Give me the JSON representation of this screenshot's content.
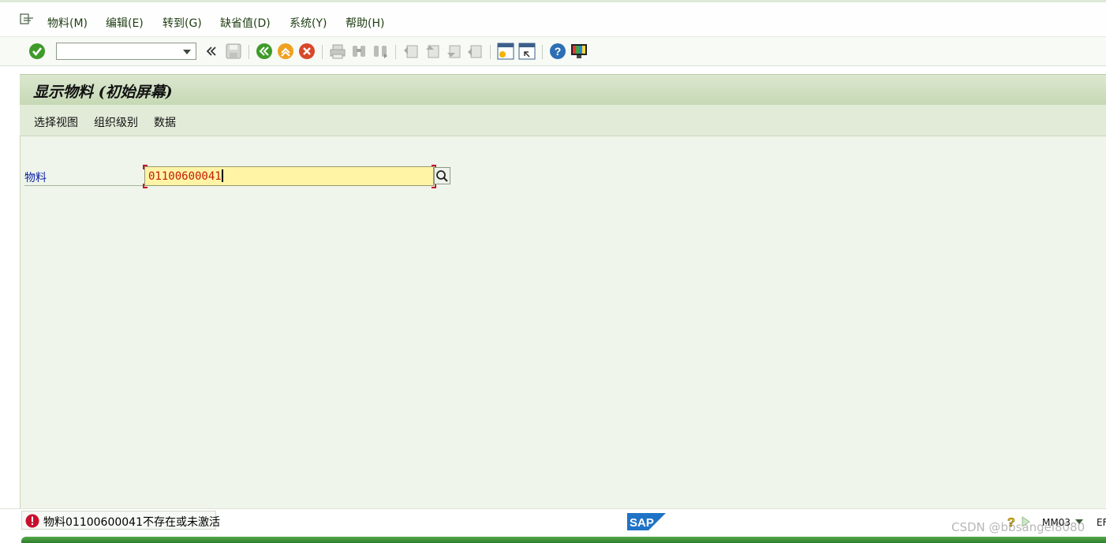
{
  "menu": {
    "items": [
      {
        "label": "物料(M)"
      },
      {
        "label": "编辑(E)"
      },
      {
        "label": "转到(G)"
      },
      {
        "label": "缺省值(D)"
      },
      {
        "label": "系统(Y)"
      },
      {
        "label": "帮助(H)"
      }
    ]
  },
  "toolbar": {
    "command_field_value": "",
    "icons": [
      "enter-icon",
      "command-dropdown",
      "collapse-icon",
      "save-icon",
      "back-icon",
      "exit-icon",
      "cancel-icon",
      "print-icon",
      "find-icon",
      "find-next-icon",
      "first-page-icon",
      "previous-page-icon",
      "next-page-icon",
      "last-page-icon",
      "create-session-icon",
      "generate-shortcut-icon",
      "help-icon",
      "layout-icon"
    ]
  },
  "screen": {
    "title": "显示物料 (初始屏幕)"
  },
  "app_toolbar": {
    "buttons": [
      {
        "label": "选择视图"
      },
      {
        "label": "组织级别"
      },
      {
        "label": "数据"
      }
    ]
  },
  "form": {
    "material_label": "物料",
    "material_value": "01100600041"
  },
  "status": {
    "message": "物料01100600041不存在或未激活",
    "type": "error",
    "transaction": "MM03",
    "system": "EF",
    "watermark": "CSDN @bbsangel8080"
  },
  "colors": {
    "accent_green": "#2d7d2b",
    "input_highlight": "#fff3a6",
    "error_red": "#c8102e",
    "label_blue": "#0b1fa8"
  }
}
